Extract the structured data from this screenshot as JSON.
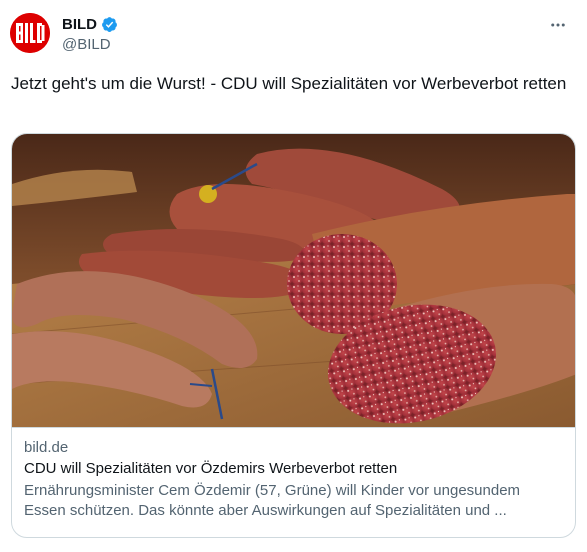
{
  "account": {
    "display_name": "BILD",
    "handle": "@BILD",
    "logo_text": "BILD",
    "verified": true,
    "brand_color": "#dd0000",
    "verified_color": "#1d9bf0"
  },
  "more_icon": "more-horizontal-icon",
  "tweet": {
    "text": "Jetzt geht's um die Wurst! - CDU will Spezialitäten vor Werbeverbot retten"
  },
  "card": {
    "domain": "bild.de",
    "title": "CDU will Spezialitäten vor Özdemirs Werbeverbot retten",
    "description": "Ernährungsminister Cem Özdemir (57, Grüne) will Kinder vor ungesundem Essen schützen. Das könnte aber Auswirkungen auf Spezialitäten und ..."
  }
}
